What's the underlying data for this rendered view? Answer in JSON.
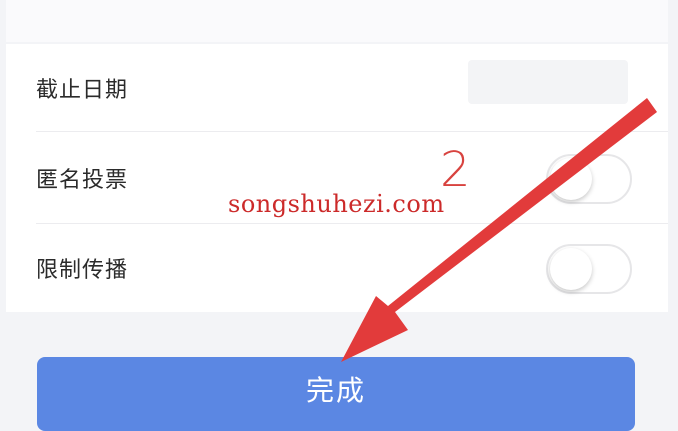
{
  "settings": {
    "deadline_label": "截止日期",
    "deadline_value": "",
    "anonymous_label": "匿名投票",
    "anonymous_on": false,
    "restrict_label": "限制传播",
    "restrict_on": false
  },
  "actions": {
    "done_label": "完成"
  },
  "annotation": {
    "step_number": "2",
    "watermark": "songshuhezi.com",
    "arrow_color": "#e23b3b"
  },
  "colors": {
    "primary_button": "#5b87e3",
    "background": "#f3f4f7"
  }
}
